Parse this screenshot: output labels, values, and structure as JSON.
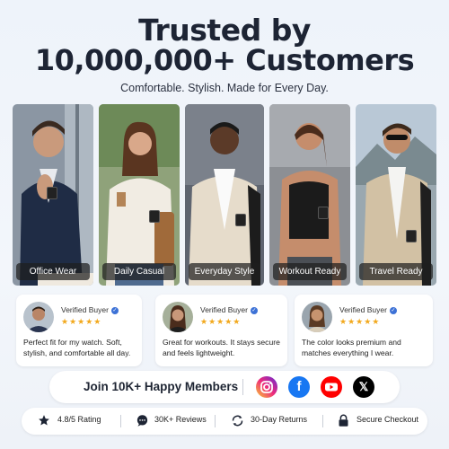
{
  "headline": {
    "line1": "Trusted by",
    "line2": "10,000,000+ Customers"
  },
  "subheadline": "Comfortable. Stylish. Made for Every Day.",
  "styles": [
    {
      "label": "Office Wear"
    },
    {
      "label": "Daily Casual"
    },
    {
      "label": "Everyday Style"
    },
    {
      "label": "Workout Ready"
    },
    {
      "label": "Travel Ready"
    }
  ],
  "reviews": [
    {
      "badge": "Verified Buyer",
      "stars": "★★★★★",
      "rating": 5,
      "text": "Perfect fit for my watch. Soft, stylish, and comfortable all day."
    },
    {
      "badge": "Verified Buyer",
      "stars": "★★★★★",
      "rating": 5,
      "text": "Great for workouts. It stays secure and feels lightweight."
    },
    {
      "badge": "Verified Buyer",
      "stars": "★★★★★",
      "rating": 5,
      "text": "The color looks premium and matches everything I wear."
    }
  ],
  "community": {
    "label": "Join 10K+ Happy Members",
    "socials": [
      {
        "icon": "instagram-icon",
        "color": "#d62976"
      },
      {
        "icon": "facebook-icon",
        "color": "#1877f2"
      },
      {
        "icon": "youtube-icon",
        "color": "#ff0000"
      },
      {
        "icon": "x-icon",
        "color": "#000000"
      }
    ]
  },
  "trust_bar": [
    {
      "icon": "star-icon",
      "label": "4.8/5 Rating"
    },
    {
      "icon": "chat-icon",
      "label": "30K+ Reviews"
    },
    {
      "icon": "return-icon",
      "label": "30-Day Returns"
    },
    {
      "icon": "lock-icon",
      "label": "Secure Checkout"
    }
  ],
  "colors": {
    "heading": "#1d2434",
    "star": "#f2a91e",
    "verified": "#3c71d6"
  }
}
